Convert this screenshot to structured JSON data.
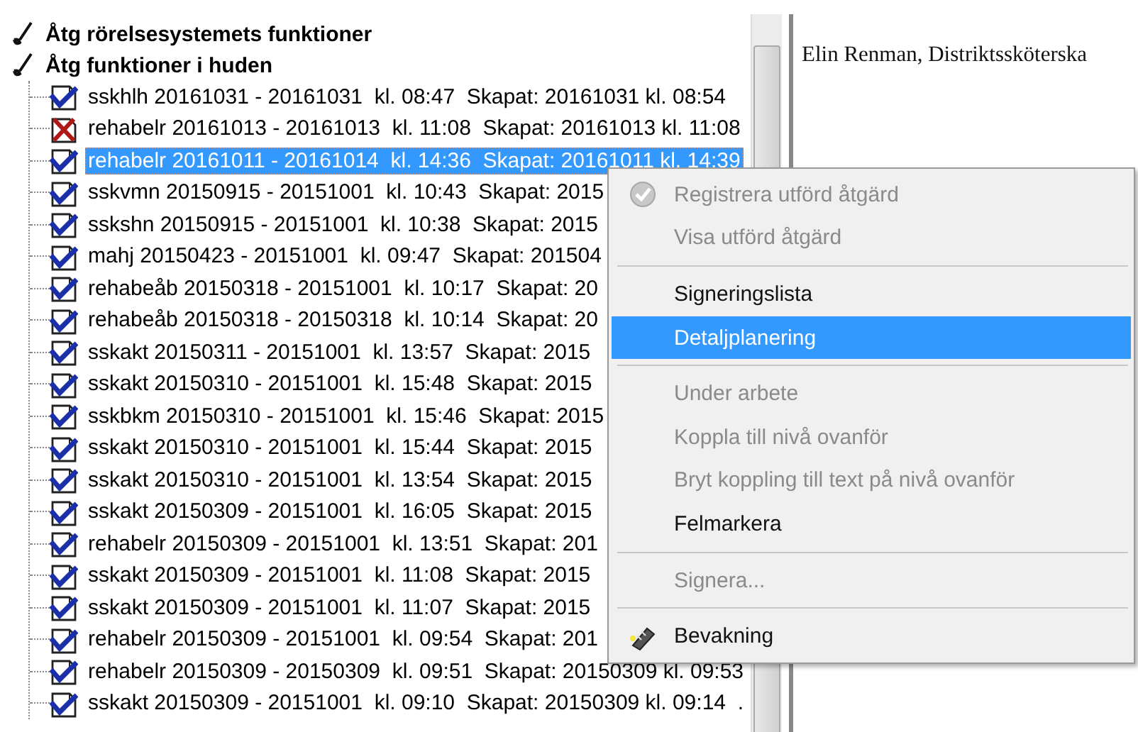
{
  "tree": {
    "groups": [
      {
        "label": "Åtg rörelsesystemets funktioner"
      },
      {
        "label": "Åtg funktioner i huden"
      }
    ],
    "rows": [
      {
        "text": "sskhlh 20161031 - 20161031  kl. 08:47  Skapat: 20161031 kl. 08:54",
        "error": false,
        "selected": false
      },
      {
        "text": "rehabelr 20161013 - 20161013  kl. 11:08  Skapat: 20161013 kl. 11:08",
        "error": true,
        "selected": false
      },
      {
        "text": "rehabelr 20161011 - 20161014  kl. 14:36  Skapat: 20161011 kl. 14:39",
        "error": false,
        "selected": true
      },
      {
        "text": "sskvmn 20150915 - 20151001  kl. 10:43  Skapat: 2015",
        "error": false,
        "selected": false
      },
      {
        "text": "sskshn 20150915 - 20151001  kl. 10:38  Skapat: 2015",
        "error": false,
        "selected": false
      },
      {
        "text": "mahj 20150423 - 20151001  kl. 09:47  Skapat: 201504",
        "error": false,
        "selected": false
      },
      {
        "text": "rehabeåb 20150318 - 20151001  kl. 10:17  Skapat: 20",
        "error": false,
        "selected": false
      },
      {
        "text": "rehabeåb 20150318 - 20150318  kl. 10:14  Skapat: 20",
        "error": false,
        "selected": false
      },
      {
        "text": "sskakt 20150311 - 20151001  kl. 13:57  Skapat: 2015",
        "error": false,
        "selected": false
      },
      {
        "text": "sskakt 20150310 - 20151001  kl. 15:48  Skapat: 2015",
        "error": false,
        "selected": false
      },
      {
        "text": "sskbkm 20150310 - 20151001  kl. 15:46  Skapat: 2015",
        "error": false,
        "selected": false
      },
      {
        "text": "sskakt 20150310 - 20151001  kl. 15:44  Skapat: 2015",
        "error": false,
        "selected": false
      },
      {
        "text": "sskakt 20150310 - 20151001  kl. 13:54  Skapat: 2015",
        "error": false,
        "selected": false
      },
      {
        "text": "sskakt 20150309 - 20151001  kl. 16:05  Skapat: 2015",
        "error": false,
        "selected": false
      },
      {
        "text": "rehabelr 20150309 - 20151001  kl. 13:51  Skapat: 201",
        "error": false,
        "selected": false
      },
      {
        "text": "sskakt 20150309 - 20151001  kl. 11:08  Skapat: 2015",
        "error": false,
        "selected": false
      },
      {
        "text": "sskakt 20150309 - 20151001  kl. 11:07  Skapat: 2015",
        "error": false,
        "selected": false
      },
      {
        "text": "rehabelr 20150309 - 20151001  kl. 09:54  Skapat: 201",
        "error": false,
        "selected": false
      },
      {
        "text": "rehabelr 20150309 - 20150309  kl. 09:51  Skapat: 20150309 kl. 09:53",
        "error": false,
        "selected": false
      },
      {
        "text": "sskakt 20150309 - 20151001  kl. 09:10  Skapat: 20150309 kl. 09:14  .",
        "error": false,
        "selected": false
      }
    ]
  },
  "detail": {
    "text": "Elin Renman, Distriktssköterska"
  },
  "context_menu": {
    "items": [
      {
        "kind": "check",
        "label": "Registrera utförd åtgärd",
        "disabled": true,
        "selected": false
      },
      {
        "kind": "plain",
        "label": "Visa utförd åtgärd",
        "disabled": true,
        "selected": false
      },
      {
        "kind": "separator"
      },
      {
        "kind": "plain",
        "label": "Signeringslista",
        "disabled": false,
        "selected": false
      },
      {
        "kind": "plain",
        "label": "Detaljplanering",
        "disabled": false,
        "selected": true
      },
      {
        "kind": "separator"
      },
      {
        "kind": "plain",
        "label": "Under arbete",
        "disabled": true,
        "selected": false
      },
      {
        "kind": "plain",
        "label": "Koppla till nivå ovanför",
        "disabled": true,
        "selected": false
      },
      {
        "kind": "plain",
        "label": "Bryt koppling till text på nivå ovanför",
        "disabled": true,
        "selected": false
      },
      {
        "kind": "plain",
        "label": "Felmarkera",
        "disabled": false,
        "selected": false
      },
      {
        "kind": "separator"
      },
      {
        "kind": "plain",
        "label": "Signera...",
        "disabled": true,
        "selected": false
      },
      {
        "kind": "separator"
      },
      {
        "kind": "pen",
        "label": "Bevakning",
        "disabled": false,
        "selected": false
      }
    ]
  }
}
